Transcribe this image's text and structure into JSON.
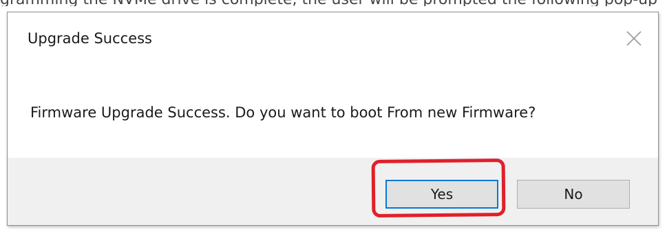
{
  "background": {
    "partial_text": "gramming the NVMe drive is complete, the user will be prompted the following pop-up"
  },
  "dialog": {
    "title": "Upgrade Success",
    "close_icon": "close-icon",
    "message": "Firmware Upgrade Success. Do you want to boot From new Firmware?",
    "buttons": {
      "yes_label": "Yes",
      "no_label": "No"
    }
  },
  "colors": {
    "annotation": "#e0202a",
    "focus_border": "#0078d7",
    "footer_bg": "#f0f0f0",
    "button_bg": "#e1e1e1"
  }
}
